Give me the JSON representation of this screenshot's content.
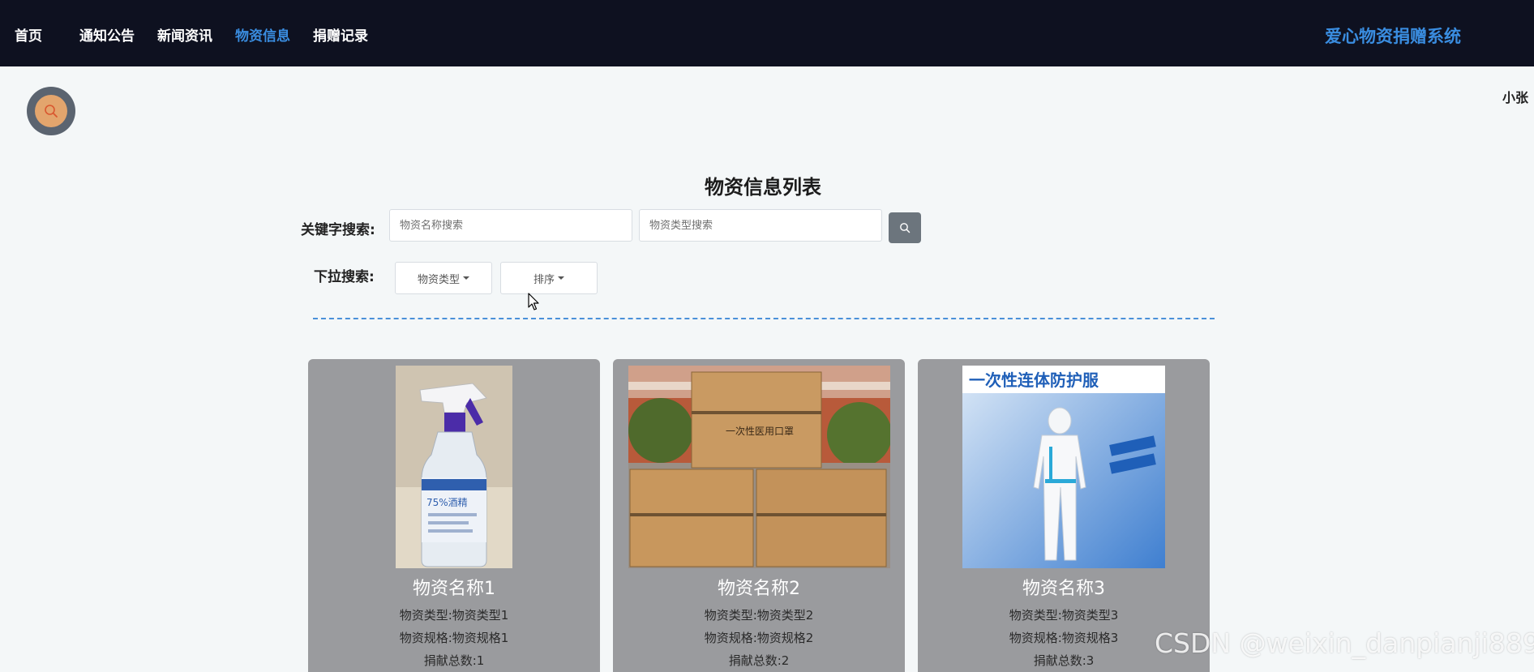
{
  "nav": {
    "items": [
      {
        "label": "首页"
      },
      {
        "label": "通知公告"
      },
      {
        "label": "新闻资讯"
      },
      {
        "label": "物资信息"
      },
      {
        "label": "捐赠记录"
      }
    ],
    "brand": "爱心物资捐赠系统"
  },
  "user": {
    "name": "小张",
    "avatar_icon": "search-icon"
  },
  "main": {
    "title": "物资信息列表",
    "keyword_label": "关键字搜索:",
    "name_placeholder": "物资名称搜索",
    "type_placeholder": "物资类型搜索",
    "dropdown_label": "下拉搜索:",
    "type_dropdown": "物资类型",
    "sort_dropdown": "排序"
  },
  "cards": [
    {
      "name": "物资名称1",
      "type": "物资类型:物资类型1",
      "spec": "物资规格:物资规格1",
      "total": "捐献总数:1",
      "image_text": "75%酒精"
    },
    {
      "name": "物资名称2",
      "type": "物资类型:物资类型2",
      "spec": "物资规格:物资规格2",
      "total": "捐献总数:2",
      "image_text": "一次性医用口罩"
    },
    {
      "name": "物资名称3",
      "type": "物资类型:物资类型3",
      "spec": "物资规格:物资规格3",
      "total": "捐献总数:3",
      "image_text": "一次性连体防护服"
    }
  ],
  "watermark": "CSDN @weixin_danpianji889",
  "colors": {
    "nav_bg": "#0e1120",
    "accent": "#3a8de0",
    "card_bg": "#9a9b9e",
    "avatar_ring": "#5b6470",
    "avatar_fill": "#e3a56d"
  }
}
